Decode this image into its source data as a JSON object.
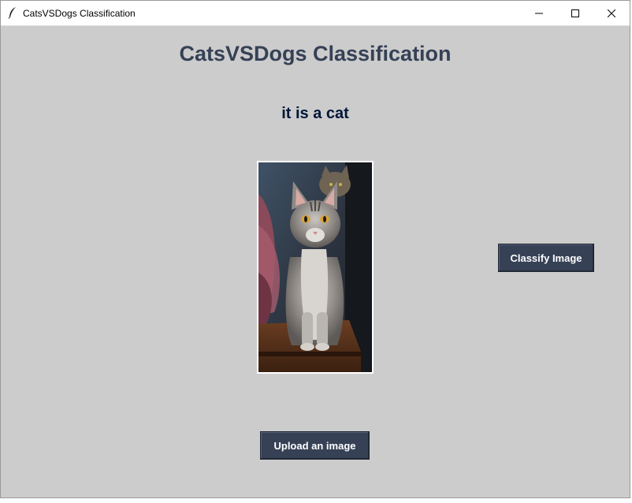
{
  "window": {
    "title": "CatsVSDogs Classification",
    "icon": "feather-icon"
  },
  "controls": {
    "minimize_icon": "minimize-icon",
    "maximize_icon": "maximize-icon",
    "close_icon": "close-icon"
  },
  "main": {
    "heading": "CatsVSDogs Classification",
    "result": "it is a cat",
    "classify_label": "Classify Image",
    "upload_label": "Upload an image"
  },
  "colors": {
    "background": "#cccccc",
    "button": "#364156",
    "heading": "#364156",
    "result": "#011638"
  }
}
